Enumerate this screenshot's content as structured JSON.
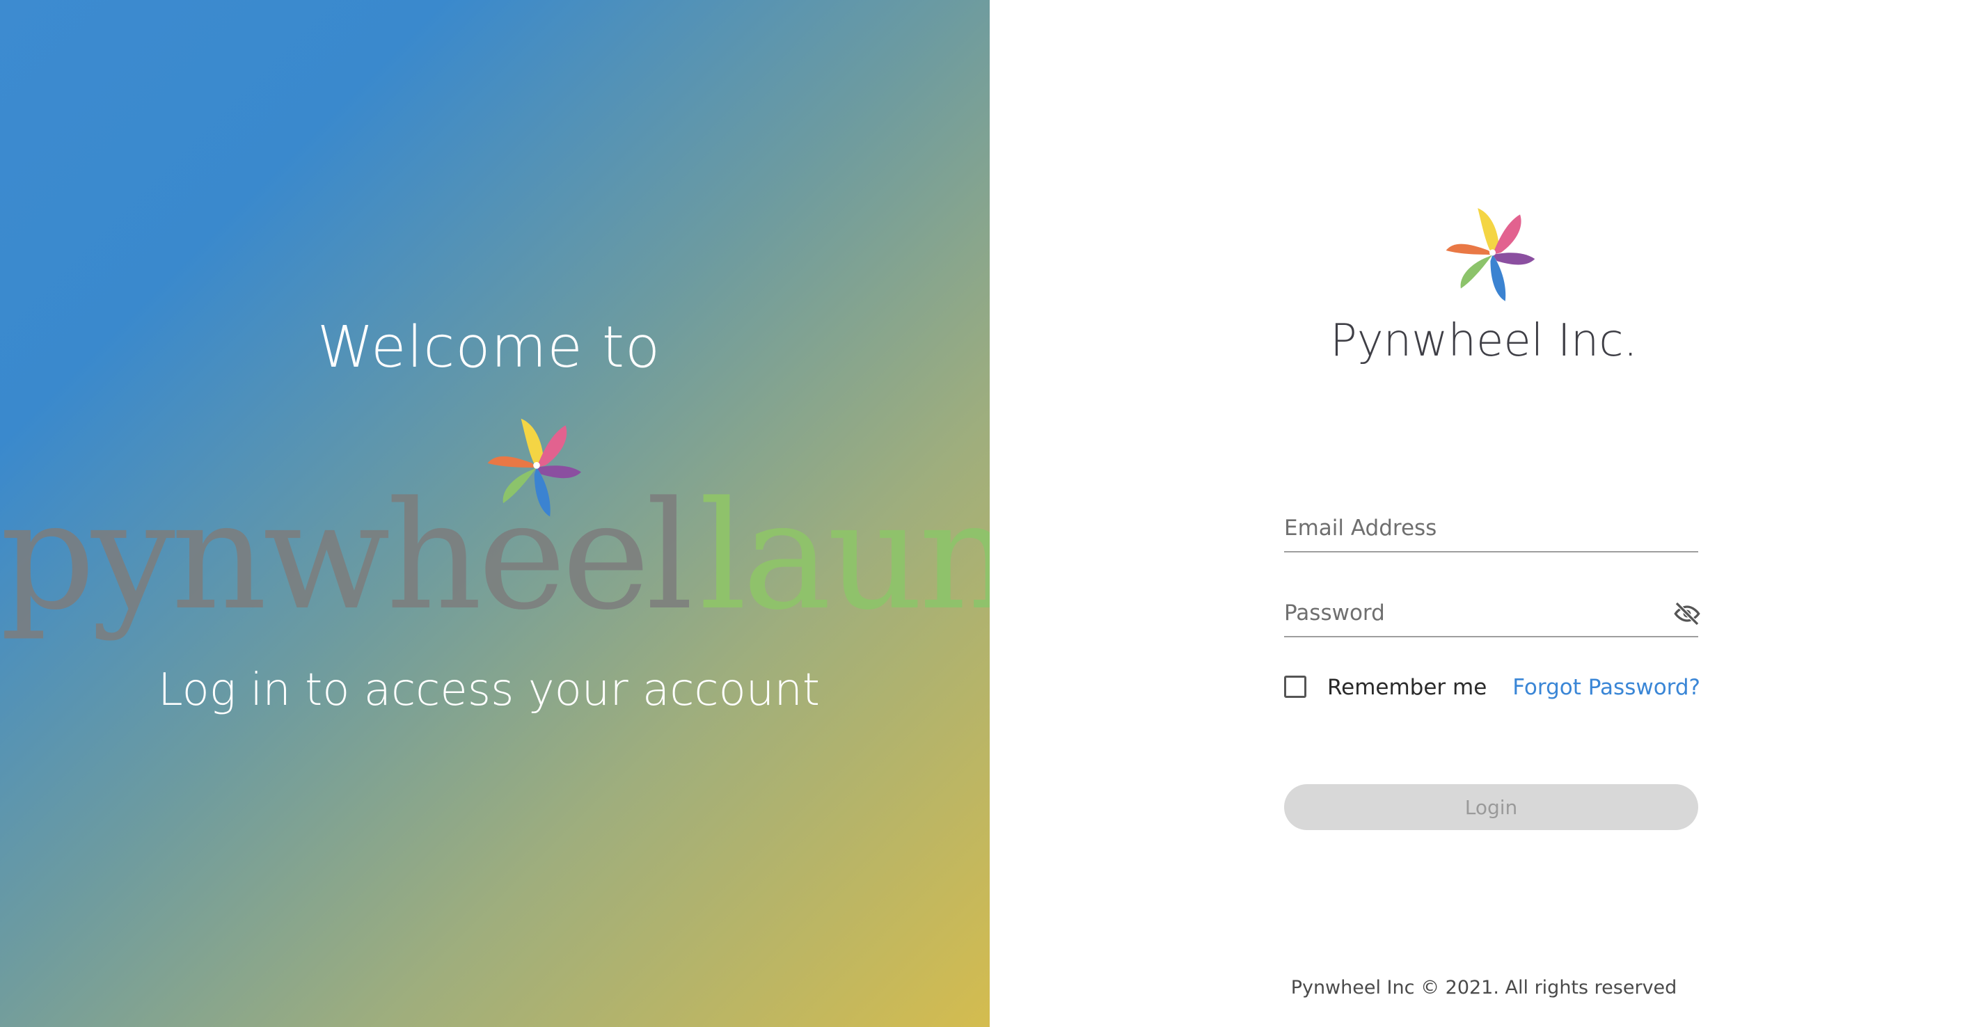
{
  "hero": {
    "welcome": "Welcome to",
    "wordmark_part1": "pynwheel",
    "wordmark_part2": "launch",
    "tagline": "Log in to access your account",
    "logo_icon": "pinwheel-logo-icon"
  },
  "brand": {
    "name": "Pynwheel Inc.",
    "logo_icon": "pinwheel-logo-icon"
  },
  "form": {
    "email_placeholder": "Email Address",
    "email_value": "",
    "password_placeholder": "Password",
    "password_value": "",
    "password_toggle_icon": "eye-off-icon",
    "remember_label": "Remember me",
    "remember_checked": false,
    "forgot_label": "Forgot Password?",
    "login_label": "Login"
  },
  "footer": {
    "text": "Pynwheel Inc © 2021. All rights reserved"
  },
  "colors": {
    "accent_link": "#3a86d6",
    "button_disabled_bg": "#d8d8d8",
    "wordmark_launch": "#8fc26b",
    "gradient_start": "#3d8bd0",
    "gradient_end": "#d4bc4f"
  }
}
